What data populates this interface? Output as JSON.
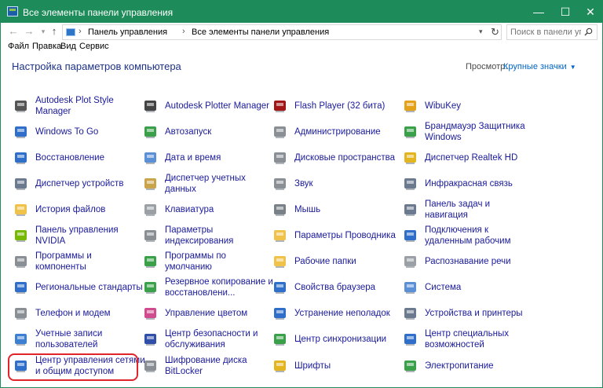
{
  "window": {
    "title": "Все элементы панели управления",
    "minimize": "—",
    "maximize": "☐",
    "close": "✕"
  },
  "address": {
    "crumbs": [
      "Панель управления",
      "Все элементы панели управления"
    ],
    "search_placeholder": "Поиск в панели управ..."
  },
  "menu": [
    "Файл",
    "Правка",
    "Вид",
    "Сервис"
  ],
  "header": {
    "title": "Настройка параметров компьютера",
    "view_label": "Просмотр:",
    "view_value": "Крупные значки"
  },
  "columns": [
    [
      {
        "label": "Autodesk Plot Style\nManager",
        "icon": "printer-style-icon"
      },
      {
        "label": "Windows To Go",
        "icon": "windows-to-go-icon"
      },
      {
        "label": "Восстановление",
        "icon": "recovery-icon"
      },
      {
        "label": "Диспетчер устройств",
        "icon": "device-manager-icon"
      },
      {
        "label": "История файлов",
        "icon": "file-history-icon"
      },
      {
        "label": "Панель управления\nNVIDIA",
        "icon": "nvidia-icon"
      },
      {
        "label": "Программы и\nкомпоненты",
        "icon": "programs-icon"
      },
      {
        "label": "Региональные стандарты",
        "icon": "region-icon"
      },
      {
        "label": "Телефон и модем",
        "icon": "phone-modem-icon"
      },
      {
        "label": "Учетные записи\nпользователей",
        "icon": "user-accounts-icon"
      },
      {
        "label": "Центр управления сетями\nи общим доступом",
        "icon": "network-center-icon"
      }
    ],
    [
      {
        "label": "Autodesk Plotter Manager",
        "icon": "plotter-icon"
      },
      {
        "label": "Автозапуск",
        "icon": "autoplay-icon"
      },
      {
        "label": "Дата и время",
        "icon": "date-time-icon"
      },
      {
        "label": "Диспетчер учетных\nданных",
        "icon": "credential-manager-icon"
      },
      {
        "label": "Клавиатура",
        "icon": "keyboard-icon"
      },
      {
        "label": "Параметры\nиндексирования",
        "icon": "indexing-icon"
      },
      {
        "label": "Программы по\nумолчанию",
        "icon": "default-programs-icon"
      },
      {
        "label": "Резервное копирование и\nвосстановлени...",
        "icon": "backup-icon"
      },
      {
        "label": "Управление цветом",
        "icon": "color-management-icon"
      },
      {
        "label": "Центр безопасности и\nобслуживания",
        "icon": "security-flag-icon"
      },
      {
        "label": "Шифрование диска\nBitLocker",
        "icon": "bitlocker-icon"
      }
    ],
    [
      {
        "label": "Flash Player (32 бита)",
        "icon": "flash-icon"
      },
      {
        "label": "Администрирование",
        "icon": "admin-tools-icon"
      },
      {
        "label": "Дисковые пространства",
        "icon": "storage-spaces-icon"
      },
      {
        "label": "Звук",
        "icon": "sound-icon"
      },
      {
        "label": "Мышь",
        "icon": "mouse-icon"
      },
      {
        "label": "Параметры Проводника",
        "icon": "explorer-options-icon"
      },
      {
        "label": "Рабочие папки",
        "icon": "work-folders-icon"
      },
      {
        "label": "Свойства браузера",
        "icon": "browser-properties-icon"
      },
      {
        "label": "Устранение неполадок",
        "icon": "troubleshooting-icon"
      },
      {
        "label": "Центр синхронизации",
        "icon": "sync-center-icon"
      },
      {
        "label": "Шрифты",
        "icon": "fonts-icon"
      }
    ],
    [
      {
        "label": "WibuKey",
        "icon": "wibukey-icon"
      },
      {
        "label": "Брандмауэр Защитника\nWindows",
        "icon": "firewall-icon"
      },
      {
        "label": "Диспетчер Realtek HD",
        "icon": "realtek-icon"
      },
      {
        "label": "Инфракрасная связь",
        "icon": "infrared-icon"
      },
      {
        "label": "Панель задач и\nнавигация",
        "icon": "taskbar-icon"
      },
      {
        "label": "Подключения к\nудаленным рабочим",
        "icon": "remote-desktop-icon"
      },
      {
        "label": "Распознавание речи",
        "icon": "speech-icon"
      },
      {
        "label": "Система",
        "icon": "system-icon"
      },
      {
        "label": "Устройства и принтеры",
        "icon": "devices-printers-icon"
      },
      {
        "label": "Центр специальных\nвозможностей",
        "icon": "ease-of-access-icon"
      },
      {
        "label": "Электропитание",
        "icon": "power-options-icon"
      }
    ]
  ]
}
